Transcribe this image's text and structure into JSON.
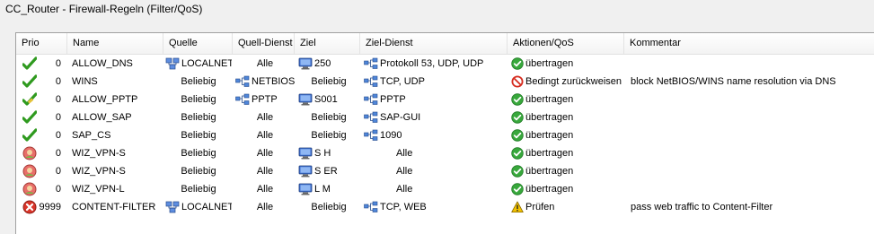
{
  "window": {
    "title": "CC_Router - Firewall-Regeln (Filter/QoS)"
  },
  "columns": {
    "prio": "Prio",
    "name": "Name",
    "quelle": "Quelle",
    "quell_dienst": "Quell-Dienst",
    "ziel": "Ziel",
    "ziel_dienst": "Ziel-Dienst",
    "aktion": "Aktionen/QoS",
    "kommentar": "Kommentar"
  },
  "rows": [
    {
      "status_icon": "check-icon",
      "prio": "0",
      "name": "ALLOW_DNS",
      "quelle": "LOCALNET",
      "quelle_icon": "network-icon",
      "quell_dienst": "Alle",
      "quell_dienst_icon": "",
      "ziel": "250",
      "ziel_icon": "computer-icon",
      "ziel_dienst": "Protokoll 53, UDP, UDP",
      "ziel_dienst_icon": "service-icon",
      "aktion": "übertragen",
      "aktion_icon": "ok-circle-icon",
      "kommentar": ""
    },
    {
      "status_icon": "check-icon",
      "prio": "0",
      "name": "WINS",
      "quelle": "Beliebig",
      "quelle_icon": "",
      "quell_dienst": "NETBIOS",
      "quell_dienst_icon": "service-icon",
      "ziel": "Beliebig",
      "ziel_icon": "",
      "ziel_dienst": "TCP, UDP",
      "ziel_dienst_icon": "service-icon",
      "aktion": "Bedingt zurückweisen",
      "aktion_icon": "block-icon",
      "kommentar": "block NetBIOS/WINS name resolution via DNS"
    },
    {
      "status_icon": "check-edit-icon",
      "prio": "0",
      "name": "ALLOW_PPTP",
      "quelle": "Beliebig",
      "quelle_icon": "",
      "quell_dienst": "PPTP",
      "quell_dienst_icon": "service-icon",
      "ziel": "S001",
      "ziel_icon": "computer-icon",
      "ziel_dienst": "PPTP",
      "ziel_dienst_icon": "service-icon",
      "aktion": "übertragen",
      "aktion_icon": "ok-circle-icon",
      "kommentar": ""
    },
    {
      "status_icon": "check-icon",
      "prio": "0",
      "name": "ALLOW_SAP",
      "quelle": "Beliebig",
      "quelle_icon": "",
      "quell_dienst": "Alle",
      "quell_dienst_icon": "",
      "ziel": "Beliebig",
      "ziel_icon": "",
      "ziel_dienst": "SAP-GUI",
      "ziel_dienst_icon": "service-icon",
      "aktion": "übertragen",
      "aktion_icon": "ok-circle-icon",
      "kommentar": ""
    },
    {
      "status_icon": "check-icon",
      "prio": "0",
      "name": "SAP_CS",
      "quelle": "Beliebig",
      "quelle_icon": "",
      "quell_dienst": "Alle",
      "quell_dienst_icon": "",
      "ziel": "Beliebig",
      "ziel_icon": "",
      "ziel_dienst": "1090",
      "ziel_dienst_icon": "service-icon",
      "aktion": "übertragen",
      "aktion_icon": "ok-circle-icon",
      "kommentar": ""
    },
    {
      "status_icon": "vpn-user-icon",
      "prio": "0",
      "name": "WIZ_VPN-S",
      "quelle": "Beliebig",
      "quelle_icon": "",
      "quell_dienst": "Alle",
      "quell_dienst_icon": "",
      "ziel": "S          H",
      "ziel_icon": "computer-icon",
      "ziel_dienst": "Alle",
      "ziel_dienst_icon": "",
      "aktion": "übertragen",
      "aktion_icon": "ok-circle-icon",
      "kommentar": ""
    },
    {
      "status_icon": "vpn-user-icon",
      "prio": "0",
      "name": "WIZ_VPN-S",
      "quelle": "Beliebig",
      "quelle_icon": "",
      "quell_dienst": "Alle",
      "quell_dienst_icon": "",
      "ziel": "S         ER",
      "ziel_icon": "computer-icon",
      "ziel_dienst": "Alle",
      "ziel_dienst_icon": "",
      "aktion": "übertragen",
      "aktion_icon": "ok-circle-icon",
      "kommentar": ""
    },
    {
      "status_icon": "vpn-user-icon",
      "prio": "0",
      "name": "WIZ_VPN-L",
      "quelle": "Beliebig",
      "quelle_icon": "",
      "quell_dienst": "Alle",
      "quell_dienst_icon": "",
      "ziel": "L         M",
      "ziel_icon": "computer-icon",
      "ziel_dienst": "Alle",
      "ziel_dienst_icon": "",
      "aktion": "übertragen",
      "aktion_icon": "ok-circle-icon",
      "kommentar": ""
    },
    {
      "status_icon": "deny-icon",
      "prio": "9999",
      "name": "CONTENT-FILTER",
      "quelle": "LOCALNET",
      "quelle_icon": "network-icon",
      "quell_dienst": "Alle",
      "quell_dienst_icon": "",
      "ziel": "Beliebig",
      "ziel_icon": "",
      "ziel_dienst": "TCP, WEB",
      "ziel_dienst_icon": "service-icon",
      "aktion": "Prüfen",
      "aktion_icon": "warning-icon",
      "kommentar": "pass web traffic to Content-Filter"
    }
  ],
  "colors": {
    "check": "#2f9a1f",
    "ok": "#38a83c",
    "block": "#d52b1e",
    "warning": "#f2c200",
    "network": "#3f66b5"
  }
}
